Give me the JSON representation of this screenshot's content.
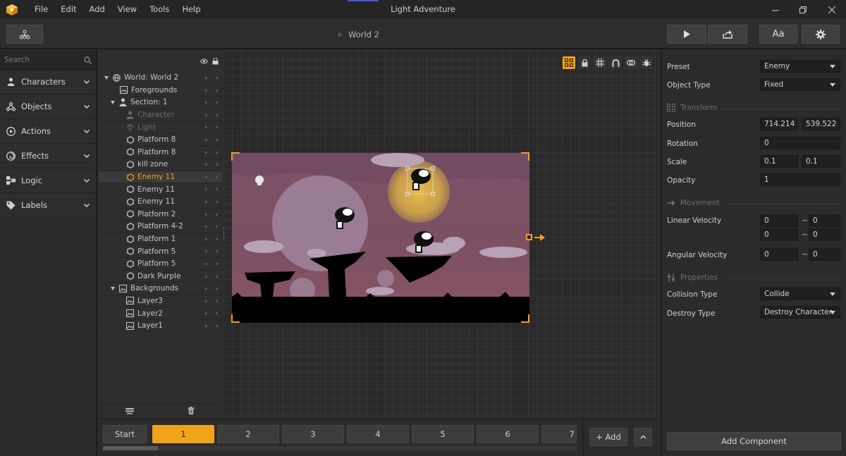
{
  "app": {
    "title": "Light Adventure",
    "menu": [
      "File",
      "Edit",
      "Add",
      "View",
      "Tools",
      "Help"
    ],
    "window_controls": [
      "minimize",
      "maximize",
      "close"
    ]
  },
  "toolbar": {
    "breadcrumb": "World 2",
    "font_button": "Aa"
  },
  "left_panel": {
    "search_placeholder": "Search",
    "categories": [
      {
        "label": "Characters",
        "icon": "person-icon"
      },
      {
        "label": "Objects",
        "icon": "objects-icon"
      },
      {
        "label": "Actions",
        "icon": "play-circle-icon"
      },
      {
        "label": "Effects",
        "icon": "swirl-icon"
      },
      {
        "label": "Logic",
        "icon": "logic-icon"
      },
      {
        "label": "Labels",
        "icon": "tag-icon"
      }
    ]
  },
  "hierarchy": {
    "rows": [
      {
        "label": "World: World 2",
        "indent": 0,
        "expanded": true,
        "icon": "globe-icon"
      },
      {
        "label": "Foregrounds",
        "indent": 1,
        "icon": "image-icon"
      },
      {
        "label": "Section: 1",
        "indent": 1,
        "expanded": true,
        "icon": "person-icon"
      },
      {
        "label": "Character",
        "indent": 2,
        "icon": "person-icon",
        "dim": true
      },
      {
        "label": "Light",
        "indent": 2,
        "icon": "pin-icon",
        "dim": true
      },
      {
        "label": "Platform 8",
        "indent": 2,
        "icon": "hexagon-icon"
      },
      {
        "label": "Platform 8",
        "indent": 2,
        "icon": "hexagon-icon"
      },
      {
        "label": "kill zone",
        "indent": 2,
        "icon": "hexagon-icon"
      },
      {
        "label": "Enemy 11",
        "indent": 2,
        "icon": "hexagon-icon",
        "selected": true
      },
      {
        "label": "Enemy 11",
        "indent": 2,
        "icon": "hexagon-icon"
      },
      {
        "label": "Enemy 11",
        "indent": 2,
        "icon": "hexagon-icon"
      },
      {
        "label": "Platform 2",
        "indent": 2,
        "icon": "hexagon-icon"
      },
      {
        "label": "Platform 4-2",
        "indent": 2,
        "icon": "hexagon-icon"
      },
      {
        "label": "Platform 1",
        "indent": 2,
        "icon": "hexagon-icon"
      },
      {
        "label": "Platform 5",
        "indent": 2,
        "icon": "hexagon-icon"
      },
      {
        "label": "Platform 5",
        "indent": 2,
        "icon": "hexagon-icon"
      },
      {
        "label": "Dark Purple",
        "indent": 2,
        "icon": "hexagon-icon"
      },
      {
        "label": "Backgrounds",
        "indent": 1,
        "expanded": true,
        "icon": "image-icon"
      },
      {
        "label": "Layer3",
        "indent": 2,
        "icon": "image-icon"
      },
      {
        "label": "Layer2",
        "indent": 2,
        "icon": "image-icon"
      },
      {
        "label": "Layer1",
        "indent": 2,
        "icon": "image-icon"
      }
    ]
  },
  "pages": {
    "start_label": "Start",
    "items": [
      "1",
      "2",
      "3",
      "4",
      "5",
      "6",
      "7"
    ],
    "active": "1",
    "add_label": "+ Add"
  },
  "inspector": {
    "preset_label": "Preset",
    "preset_value": "Enemy",
    "object_type_label": "Object Type",
    "object_type_value": "Fixed",
    "transform_header": "Transform",
    "position_label": "Position",
    "position_x": "714.214",
    "position_y": "539.522",
    "rotation_label": "Rotation",
    "rotation_value": "0",
    "scale_label": "Scale",
    "scale_x": "0.1",
    "scale_y": "0.1",
    "opacity_label": "Opacity",
    "opacity_value": "1",
    "movement_header": "Movement",
    "linear_velocity_label": "Linear Velocity",
    "lv_min_x": "0",
    "lv_max_x": "0",
    "lv_min_y": "0",
    "lv_max_y": "0",
    "angular_velocity_label": "Angular Velocity",
    "av_min": "0",
    "av_max": "0",
    "range_sep": "~",
    "properties_header": "Properties",
    "collision_type_label": "Collision Type",
    "collision_type_value": "Collide",
    "destroy_type_label": "Destroy Type",
    "destroy_type_value": "Destroy Character",
    "add_component_label": "Add Component"
  },
  "colors": {
    "accent": "#f0a21a",
    "panel_bg": "#2b2b2b",
    "titlebar_bg": "#252525",
    "field_bg": "#1f1f1f",
    "scene_sky": "#6a4b5e"
  }
}
